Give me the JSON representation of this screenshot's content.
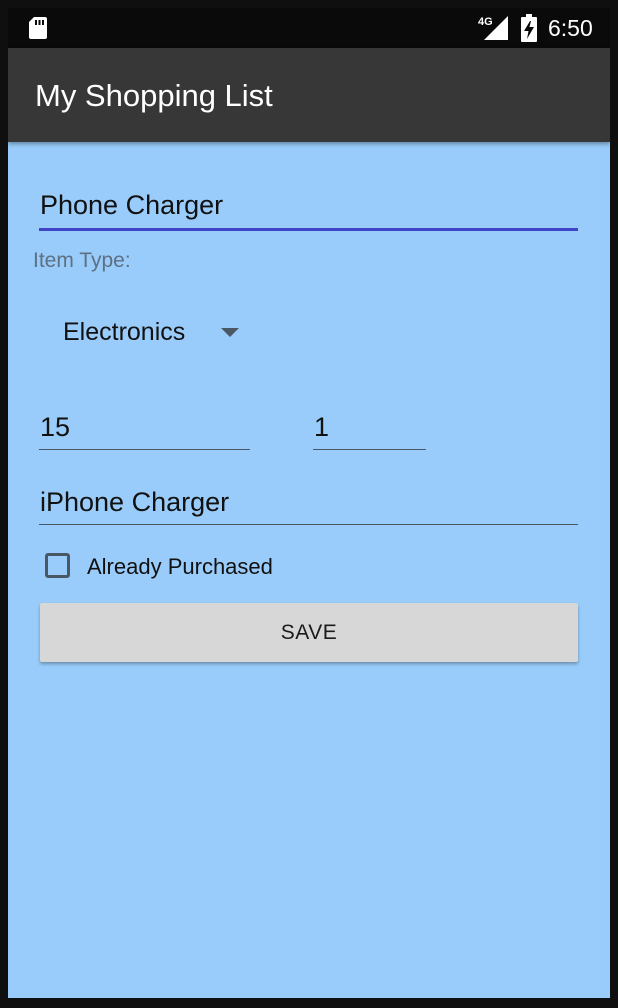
{
  "status_bar": {
    "network_label": "4G",
    "time": "6:50",
    "icons": [
      "sd-card-icon",
      "signal-icon",
      "battery-charging-icon"
    ]
  },
  "app_bar": {
    "title": "My Shopping List"
  },
  "form": {
    "item_name": "Phone Charger",
    "item_type_label": "Item Type:",
    "item_type_selected": "Electronics",
    "price": "15",
    "quantity": "1",
    "description": "iPhone Charger",
    "purchased_label": "Already Purchased",
    "purchased_checked": false,
    "save_label": "SAVE"
  },
  "colors": {
    "background": "#99ccfa",
    "app_bar": "#373737",
    "status_bar": "#0a0a0a",
    "accent_underline": "#3f45c7",
    "button": "#d7d7d7"
  }
}
